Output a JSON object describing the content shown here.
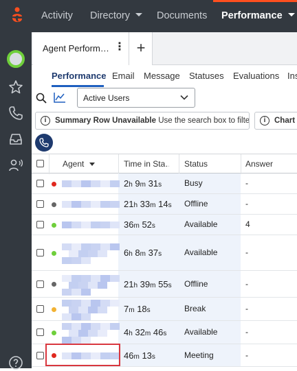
{
  "colors": {
    "nav_bg": "#333940",
    "accent": "#ff4f1f",
    "brand_blue": "#1e3a6e",
    "status_busy": "#e0281f",
    "status_offline": "#666666",
    "status_available": "#6fcf3b",
    "status_break": "#f2b233",
    "highlight": "#d9363e"
  },
  "topnav": {
    "logo": "genesys-logo-icon",
    "items": [
      {
        "label": "Activity",
        "active": false,
        "has_caret": false
      },
      {
        "label": "Directory",
        "active": false,
        "has_caret": true
      },
      {
        "label": "Documents",
        "active": false,
        "has_caret": false
      },
      {
        "label": "Performance",
        "active": true,
        "has_caret": true
      }
    ]
  },
  "sidebar": {
    "icons": [
      "avatar",
      "star-icon",
      "phone-icon",
      "inbox-icon",
      "contact-speaking-icon",
      "help-icon"
    ]
  },
  "tabs": {
    "open_tab_label": "Agent Perform…",
    "add_tab_symbol": "+"
  },
  "subtabs": [
    "Performance",
    "Email",
    "Message",
    "Statuses",
    "Evaluations",
    "Ins"
  ],
  "toolbar": {
    "filter_value": "Active Users",
    "icons": [
      "search-icon",
      "chart-icon",
      "chevron-down-icon"
    ]
  },
  "banners": [
    {
      "title": "Summary Row Unavailable",
      "text": "Use the search box to filter users"
    },
    {
      "title": "Chart U",
      "text": ""
    }
  ],
  "table": {
    "headers": [
      "Agent",
      "Time in Sta…",
      "Status",
      "Answer"
    ],
    "rows": [
      {
        "status_color": "#e0281f",
        "time": [
          [
            "2",
            "h"
          ],
          [
            "9",
            "m"
          ],
          [
            "31",
            "s"
          ]
        ],
        "status": "Busy",
        "answer": "-"
      },
      {
        "status_color": "#666666",
        "time": [
          [
            "21",
            "h"
          ],
          [
            "33",
            "m"
          ],
          [
            "14",
            "s"
          ]
        ],
        "status": "Offline",
        "answer": "-"
      },
      {
        "status_color": "#6fcf3b",
        "time": [
          [
            "36",
            "m"
          ],
          [
            "52",
            "s"
          ]
        ],
        "status": "Available",
        "answer": "4"
      },
      {
        "status_color": "#6fcf3b",
        "time": [
          [
            "6",
            "h"
          ],
          [
            "8",
            "m"
          ],
          [
            "37",
            "s"
          ]
        ],
        "status": "Available",
        "answer": "-"
      },
      {
        "status_color": "#666666",
        "time": [
          [
            "21",
            "h"
          ],
          [
            "39",
            "m"
          ],
          [
            "55",
            "s"
          ]
        ],
        "status": "Offline",
        "answer": "-"
      },
      {
        "status_color": "#f2b233",
        "time": [
          [
            "7",
            "m"
          ],
          [
            "18",
            "s"
          ]
        ],
        "status": "Break",
        "answer": "-"
      },
      {
        "status_color": "#6fcf3b",
        "time": [
          [
            "4",
            "h"
          ],
          [
            "32",
            "m"
          ],
          [
            "46",
            "s"
          ]
        ],
        "status": "Available",
        "answer": "-"
      },
      {
        "status_color": "#e0281f",
        "time": [
          [
            "46",
            "m"
          ],
          [
            "13",
            "s"
          ]
        ],
        "status": "Meeting",
        "answer": "-"
      }
    ]
  }
}
